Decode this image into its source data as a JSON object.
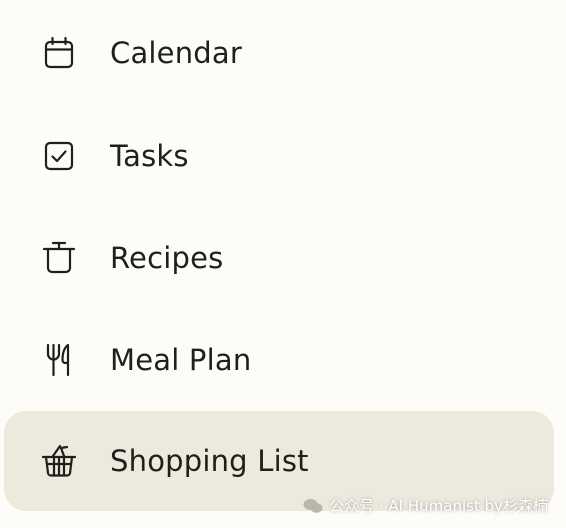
{
  "nav": {
    "items": [
      {
        "label": "Calendar",
        "icon": "calendar-icon",
        "selected": false
      },
      {
        "label": "Tasks",
        "icon": "checkbox-icon",
        "selected": false
      },
      {
        "label": "Recipes",
        "icon": "pot-icon",
        "selected": false
      },
      {
        "label": "Meal Plan",
        "icon": "fork-knife-icon",
        "selected": false
      },
      {
        "label": "Shopping List",
        "icon": "basket-icon",
        "selected": true
      }
    ]
  },
  "colors": {
    "background": "#fdfcf8",
    "selected_background": "#ece9dd",
    "text": "#1f1f1c"
  },
  "watermark": {
    "text": "公众号 · AI Humanist by杉森楠",
    "icon": "wechat-icon"
  }
}
